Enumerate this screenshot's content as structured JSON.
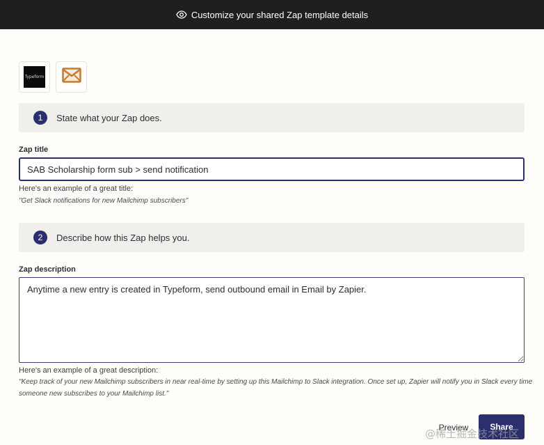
{
  "header": {
    "title": "Customize your shared Zap template details",
    "icon": "eye-icon"
  },
  "apps": [
    {
      "name": "Typeform",
      "logo_text": "Typeform",
      "icon": "typeform-icon"
    },
    {
      "name": "Email by Zapier",
      "icon": "envelope-icon",
      "color": "#c57b33"
    }
  ],
  "steps": [
    {
      "number": "1",
      "text": "State what your Zap does."
    },
    {
      "number": "2",
      "text": "Describe how this Zap helps you."
    }
  ],
  "title_field": {
    "label": "Zap title",
    "value": "SAB Scholarship form sub > send notification",
    "hint": "Here's an example of a great title:",
    "example": "\"Get Slack notifications for new Mailchimp subscribers\""
  },
  "description_field": {
    "label": "Zap description",
    "value": "Anytime a new entry is created in Typeform, send outbound email in Email by Zapier.",
    "hint": "Here's an example of a great description:",
    "example": "\"Keep track of your new Mailchimp subscribers in near real-time by setting up this Mailchimp to Slack integration. Once set up, Zapier will notify you in Slack every time someone new subscribes to your Mailchimp list.\""
  },
  "actions": {
    "preview": "Preview",
    "share": "Share"
  },
  "watermark": "@稀土掘金技术社区",
  "colors": {
    "accent": "#2c2f6e",
    "header_bg": "#1f1f1f",
    "page_bg": "#fffdf9",
    "step_bg": "#f0efeb"
  }
}
